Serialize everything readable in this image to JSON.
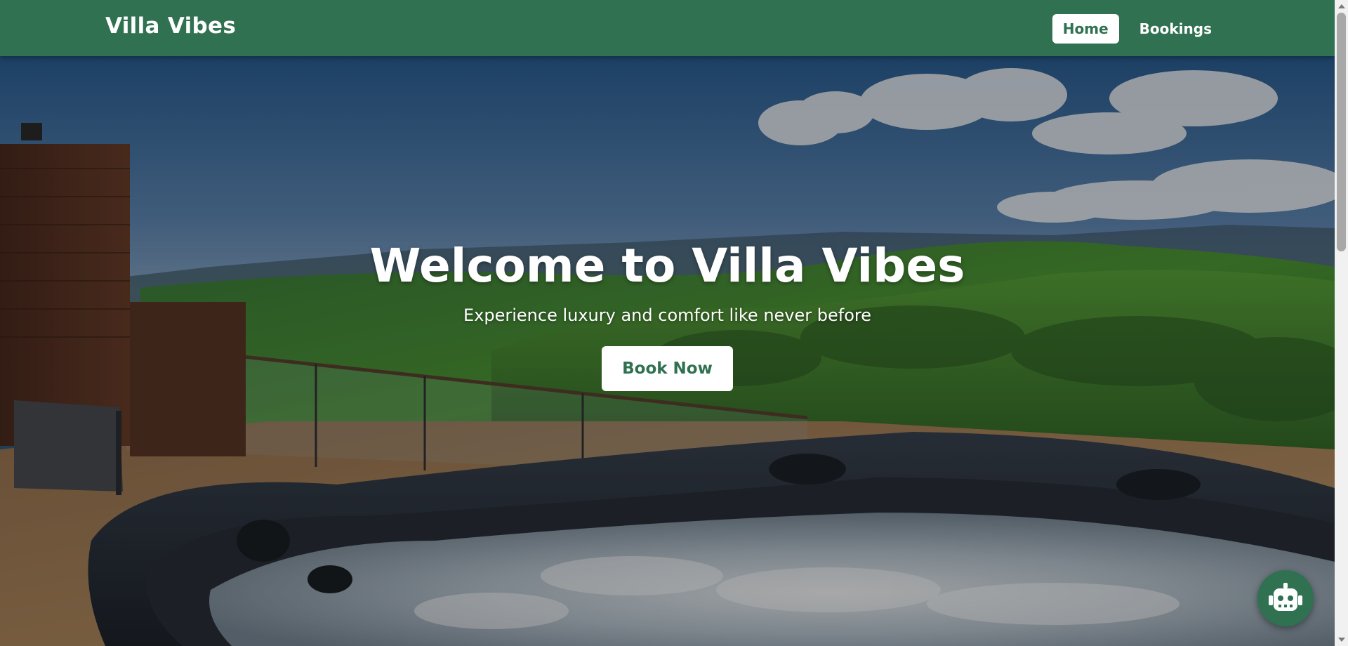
{
  "header": {
    "brand": "Villa Vibes",
    "nav": [
      {
        "label": "Home",
        "active": true
      },
      {
        "label": "Bookings",
        "active": false
      }
    ]
  },
  "hero": {
    "title": "Welcome to Villa Vibes",
    "subtitle": "Experience luxury and comfort like never before",
    "cta_label": "Book Now",
    "background": "hot-tub-mountain-view-photo"
  },
  "chat": {
    "icon": "robot-icon"
  },
  "colors": {
    "brand_green": "#2f7150",
    "white": "#ffffff"
  }
}
